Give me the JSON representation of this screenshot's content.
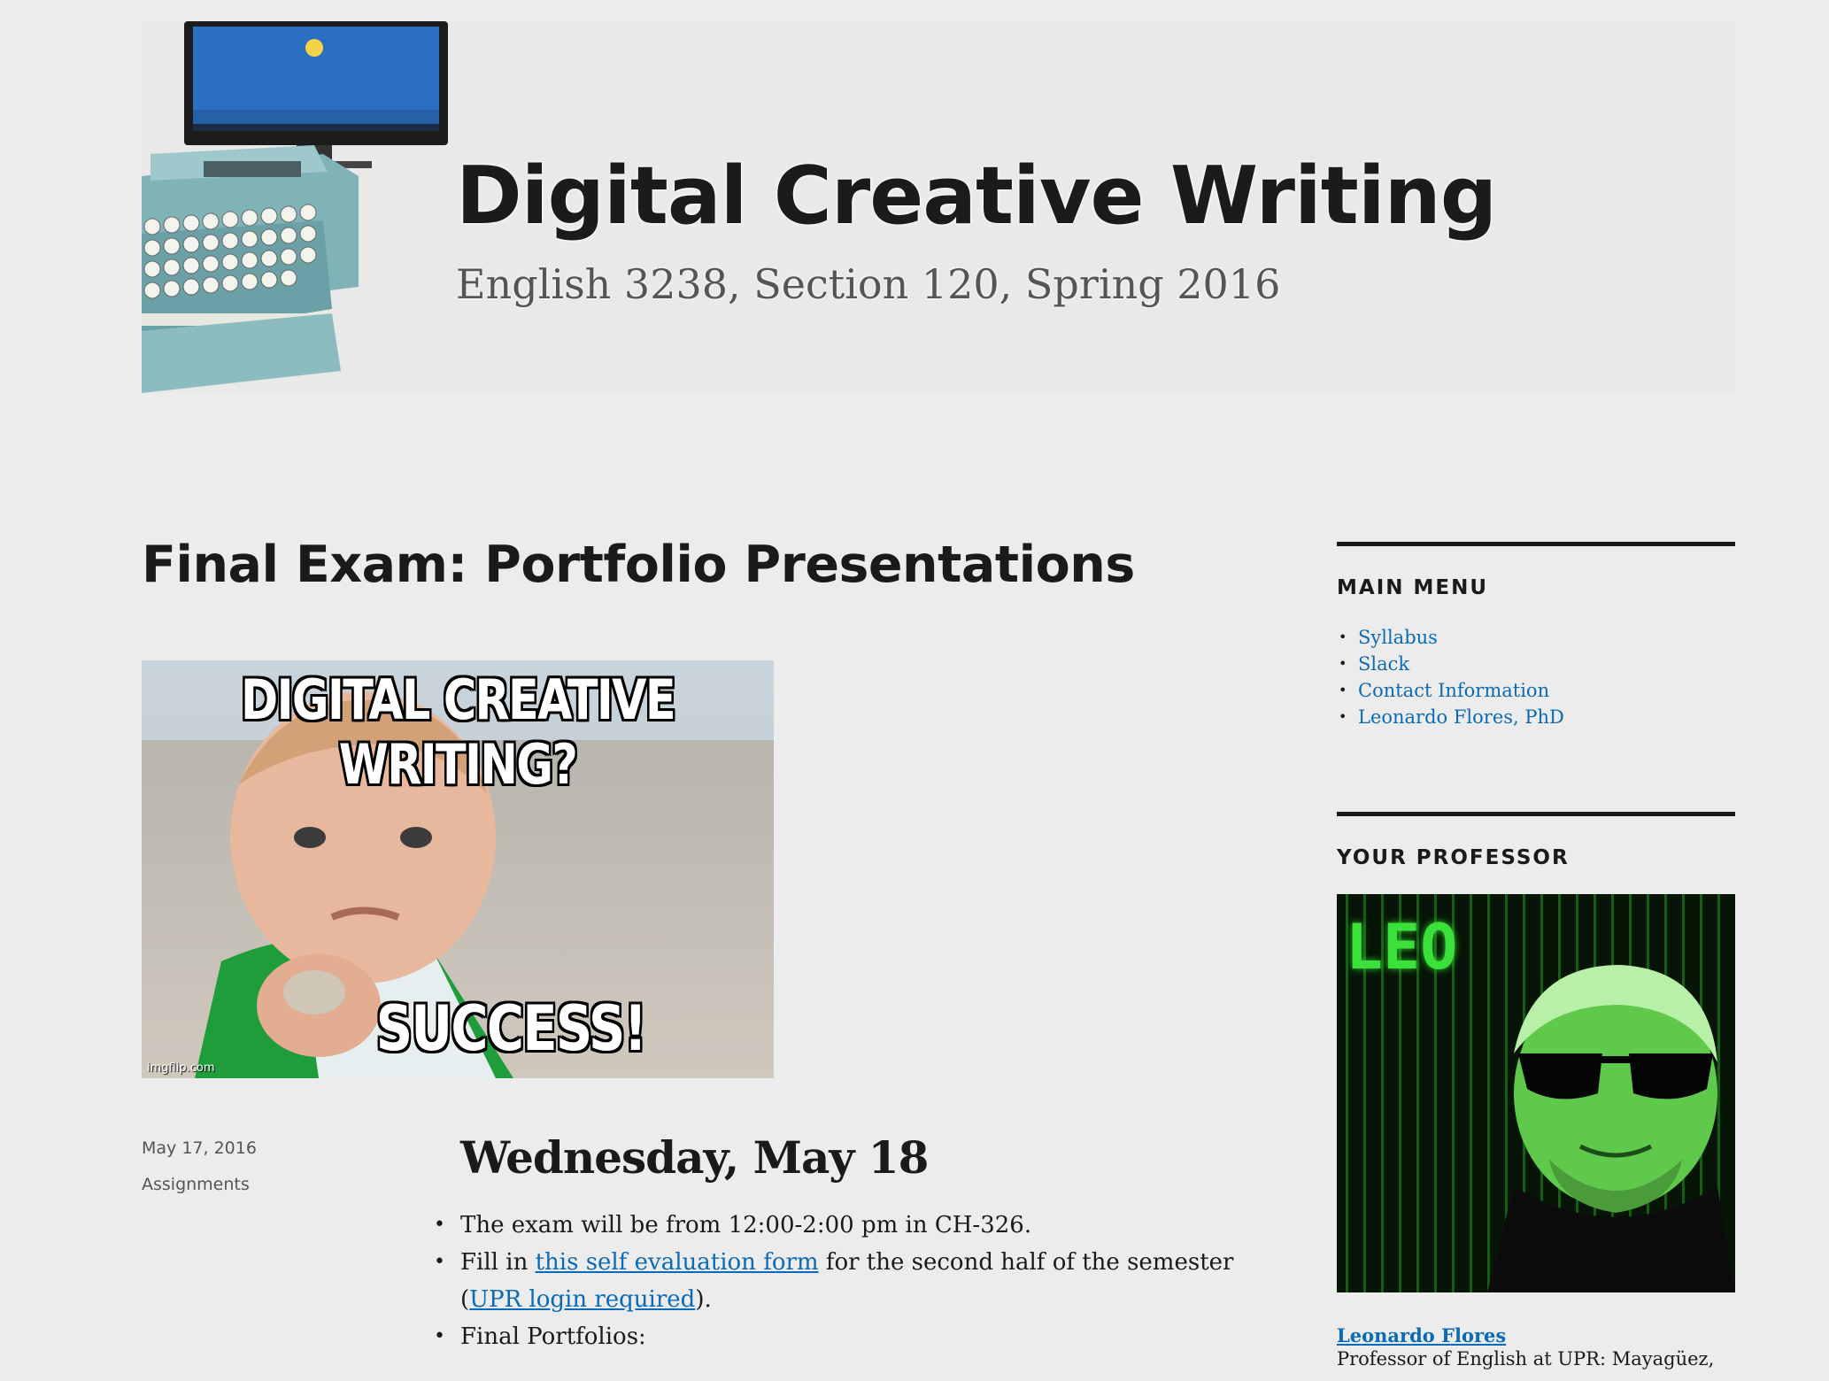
{
  "header": {
    "site_title": "Digital Creative Writing",
    "site_subtitle": "English 3238, Section 120, Spring 2016"
  },
  "post": {
    "title": "Final Exam: Portfolio Presentations",
    "featured_image": {
      "top_text": "DIGITAL CREATIVE WRITING?",
      "bottom_text": "SUCCESS!",
      "watermark": "imgflip.com"
    },
    "date": "May 17, 2016",
    "category": "Assignments",
    "content": {
      "heading": "Wednesday, May 18",
      "item1": "The exam will be from 12:00-2:00 pm in CH-326.",
      "item2_prefix": "Fill in ",
      "item2_link": "this self evaluation form",
      "item2_middle": " for the second half of the semester (",
      "item2_link2": "UPR login required",
      "item2_suffix": ").",
      "item3": "Final Portfolios:"
    }
  },
  "sidebar": {
    "main_menu": {
      "title": "MAIN MENU",
      "items": [
        "Syllabus",
        "Slack",
        "Contact Information",
        "Leonardo Flores, PhD"
      ]
    },
    "professor": {
      "title": "YOUR PROFESSOR",
      "photo_caption": "LEO",
      "name": "Leonardo Flores",
      "description": "Professor of English at UPR: Mayagüez,"
    }
  },
  "colors": {
    "background": "#ececec",
    "link": "#0b6ab7",
    "text": "#1a1a1a",
    "matrix_green": "#2fd12a"
  }
}
